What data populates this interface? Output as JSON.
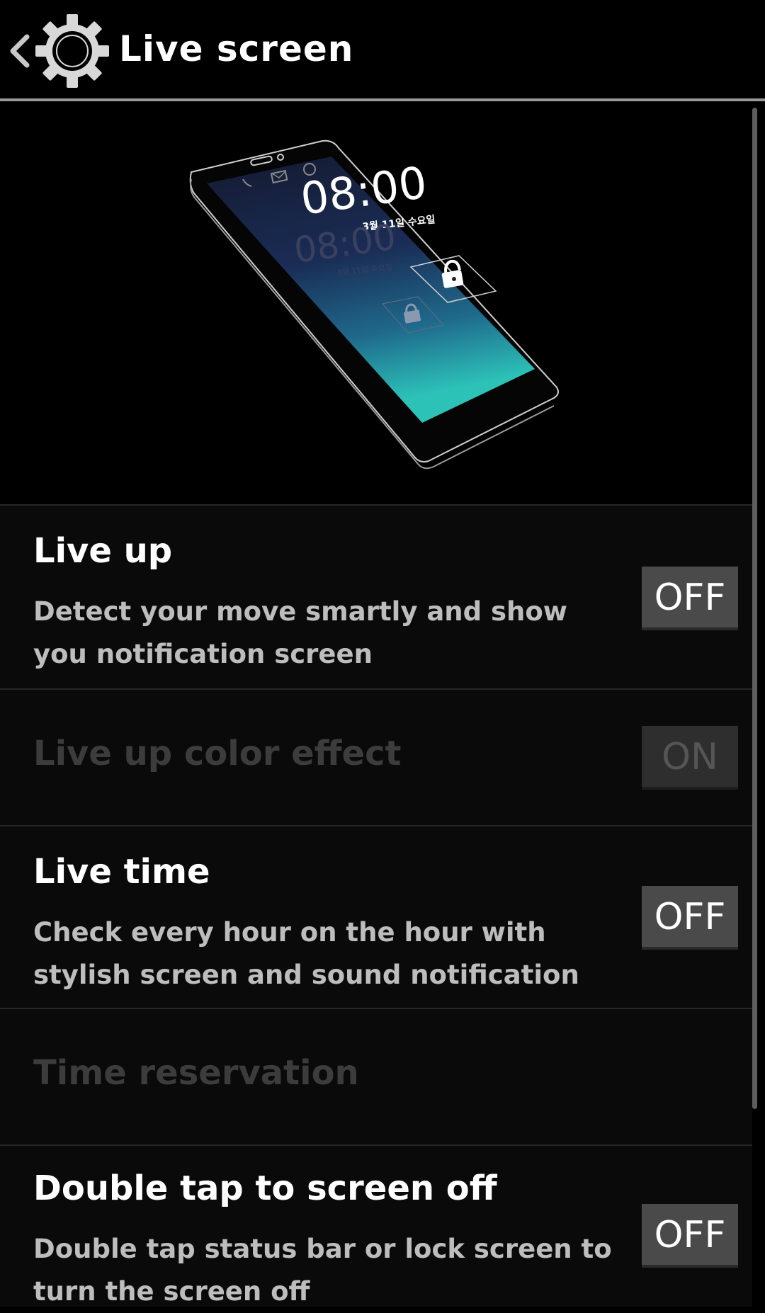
{
  "header": {
    "title": "Live screen",
    "back_icon": "chevron-left-icon",
    "settings_icon": "gear-icon"
  },
  "illustration": {
    "clock_time": "08:00",
    "clock_date": "3월 11일 수요일",
    "ghost_time": "08:00",
    "ghost_date": "3월 11일 수요일",
    "icons": [
      "phone-icon",
      "mail-icon",
      "alarm-icon",
      "lock-icon"
    ],
    "screen_gradient": [
      "#141a30",
      "#1a2d56",
      "#1f6a8c",
      "#2cc2b8"
    ]
  },
  "settings": [
    {
      "title": "Live up",
      "description": "Detect your move smartly and show you notification screen",
      "toggle": "OFF",
      "enabled": true
    },
    {
      "title": "Live up color effect",
      "description": "",
      "toggle": "ON",
      "enabled": false
    },
    {
      "title": "Live time",
      "description": "Check every hour on the hour with stylish screen and sound notification",
      "toggle": "OFF",
      "enabled": true
    },
    {
      "title": "Time reservation",
      "description": "",
      "toggle": "",
      "enabled": false
    },
    {
      "title": "Double tap to screen off",
      "description": "Double tap status bar or lock screen to turn the screen off",
      "toggle": "OFF",
      "enabled": true
    }
  ],
  "colors": {
    "background": "#000000",
    "row_background": "#0a0a0a",
    "toggle_background": "#4a4a4a",
    "disabled_text": "#3c3c3c",
    "description_text": "#bdbdbd"
  }
}
